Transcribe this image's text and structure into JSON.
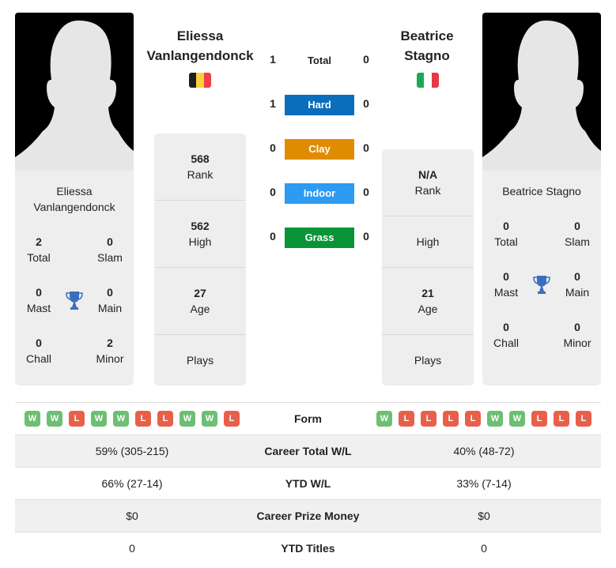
{
  "player1": {
    "name": "Eliessa Vanlangendonck",
    "name_line1": "Eliessa",
    "name_line2": "Vanlangendonck",
    "card_name_line1": "Eliessa",
    "card_name_line2": "Vanlangendonck",
    "flag": {
      "country": "Belgium",
      "colors": [
        "#1f1f1f",
        "#f9d03c",
        "#ee3f4b"
      ]
    },
    "titles": {
      "total": {
        "value": "2",
        "label": "Total"
      },
      "slam": {
        "value": "0",
        "label": "Slam"
      },
      "mast": {
        "value": "0",
        "label": "Mast"
      },
      "main": {
        "value": "0",
        "label": "Main"
      },
      "chall": {
        "value": "0",
        "label": "Chall"
      },
      "minor": {
        "value": "2",
        "label": "Minor"
      }
    },
    "stats": {
      "rank": {
        "value": "568",
        "label": "Rank"
      },
      "high": {
        "value": "562",
        "label": "High"
      },
      "age": {
        "value": "27",
        "label": "Age"
      },
      "plays": {
        "value": "",
        "label": "Plays"
      }
    },
    "form": [
      "W",
      "W",
      "L",
      "W",
      "W",
      "L",
      "L",
      "W",
      "W",
      "L"
    ]
  },
  "player2": {
    "name": "Beatrice Stagno",
    "name_line1": "Beatrice",
    "name_line2": "Stagno",
    "card_name": "Beatrice Stagno",
    "flag": {
      "country": "Italy",
      "colors": [
        "#1aaa55",
        "#ffffff",
        "#e63946"
      ]
    },
    "titles": {
      "total": {
        "value": "0",
        "label": "Total"
      },
      "slam": {
        "value": "0",
        "label": "Slam"
      },
      "mast": {
        "value": "0",
        "label": "Mast"
      },
      "main": {
        "value": "0",
        "label": "Main"
      },
      "chall": {
        "value": "0",
        "label": "Chall"
      },
      "minor": {
        "value": "0",
        "label": "Minor"
      }
    },
    "stats": {
      "rank": {
        "value": "N/A",
        "label": "Rank"
      },
      "high": {
        "value": "",
        "label": "High"
      },
      "age": {
        "value": "21",
        "label": "Age"
      },
      "plays": {
        "value": "",
        "label": "Plays"
      }
    },
    "form": [
      "W",
      "L",
      "L",
      "L",
      "L",
      "W",
      "W",
      "L",
      "L",
      "L"
    ]
  },
  "h2h": {
    "total": {
      "label": "Total",
      "p1": "1",
      "p2": "0"
    },
    "surfaces": [
      {
        "label": "Hard",
        "p1": "1",
        "p2": "0",
        "color": "#0a6ebd"
      },
      {
        "label": "Clay",
        "p1": "0",
        "p2": "0",
        "color": "#e08c00"
      },
      {
        "label": "Indoor",
        "p1": "0",
        "p2": "0",
        "color": "#2b9bf4"
      },
      {
        "label": "Grass",
        "p1": "0",
        "p2": "0",
        "color": "#0a9438"
      }
    ]
  },
  "comparison": {
    "form_label": "Form",
    "rows": [
      {
        "label": "Career Total W/L",
        "p1": "59% (305-215)",
        "p2": "40% (48-72)"
      },
      {
        "label": "YTD W/L",
        "p1": "66% (27-14)",
        "p2": "33% (7-14)"
      },
      {
        "label": "Career Prize Money",
        "p1": "$0",
        "p2": "$0"
      },
      {
        "label": "YTD Titles",
        "p1": "0",
        "p2": "0"
      }
    ]
  },
  "icons": {
    "trophy": "trophy-icon",
    "avatar": "avatar-silhouette-icon"
  }
}
